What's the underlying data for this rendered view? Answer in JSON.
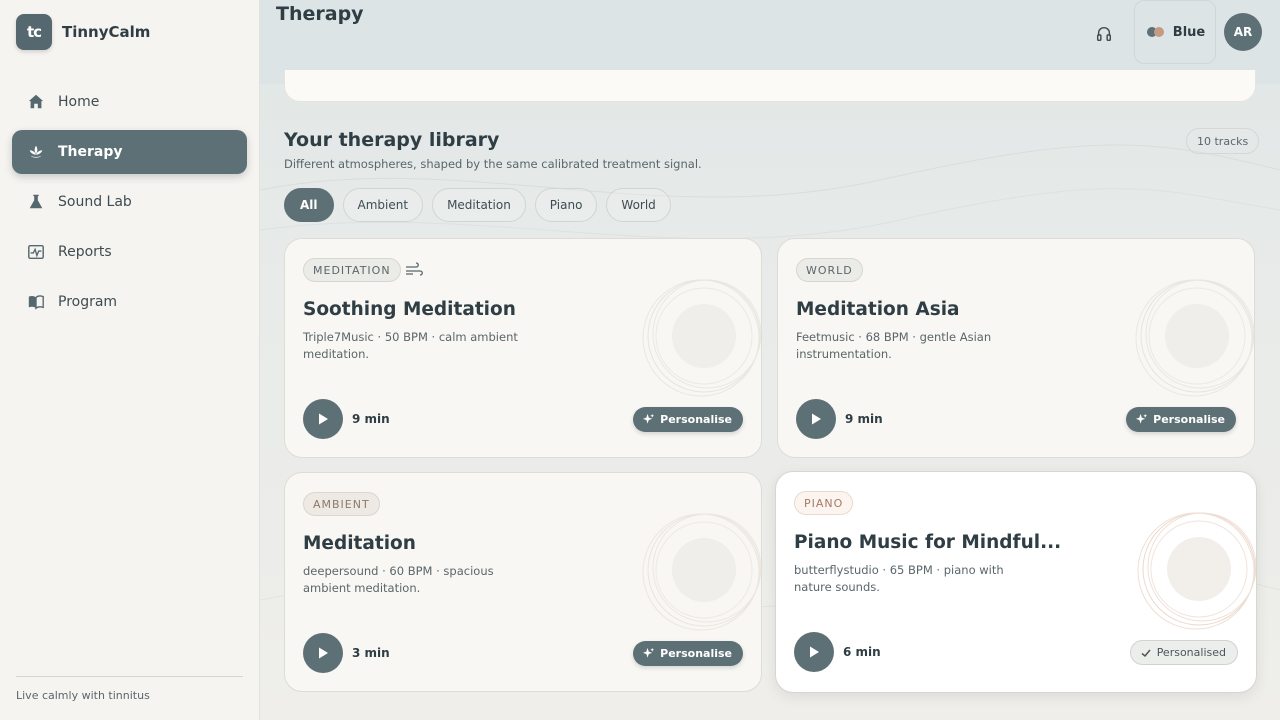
{
  "app": {
    "logo_text": "tc",
    "name": "TinnyCalm",
    "tagline": "Live calmly with tinnitus"
  },
  "nav": [
    {
      "label": "Home",
      "icon": "home-icon",
      "active": false
    },
    {
      "label": "Therapy",
      "icon": "lotus-icon",
      "active": true
    },
    {
      "label": "Sound Lab",
      "icon": "flask-icon",
      "active": false
    },
    {
      "label": "Reports",
      "icon": "chart-icon",
      "active": false
    },
    {
      "label": "Program",
      "icon": "book-icon",
      "active": false
    }
  ],
  "header": {
    "title": "Therapy",
    "theme_label": "Blue",
    "avatar_initials": "AR"
  },
  "library": {
    "title": "Your therapy library",
    "subtitle": "Different atmospheres, shaped by the same calibrated treatment signal.",
    "count_label": "10 tracks",
    "filters": [
      "All",
      "Ambient",
      "Meditation",
      "Piano",
      "World"
    ],
    "active_filter": "All"
  },
  "tracks": [
    {
      "tag": "MEDITATION",
      "title": "Soothing Meditation",
      "desc": "Triple7Music · 50 BPM · calm ambient meditation.",
      "duration": "9 min",
      "action": "Personalise",
      "personalised": false
    },
    {
      "tag": "WORLD",
      "title": "Meditation Asia",
      "desc": "Feetmusic · 68 BPM · gentle Asian instrumentation.",
      "duration": "9 min",
      "action": "Personalise",
      "personalised": false
    },
    {
      "tag": "AMBIENT",
      "title": "Meditation",
      "desc": "deepersound · 60 BPM · spacious ambient meditation.",
      "duration": "3 min",
      "action": "Personalise",
      "personalised": false
    },
    {
      "tag": "PIANO",
      "title": "Piano Music for Mindful...",
      "desc": "butterflystudio · 65 BPM · piano with nature sounds.",
      "duration": "6 min",
      "action": "Personalised",
      "personalised": true
    }
  ],
  "colors": {
    "accent": "#5d7076",
    "sidebar_bg": "#f6f4f0",
    "piano_tag": "#a57a66"
  }
}
